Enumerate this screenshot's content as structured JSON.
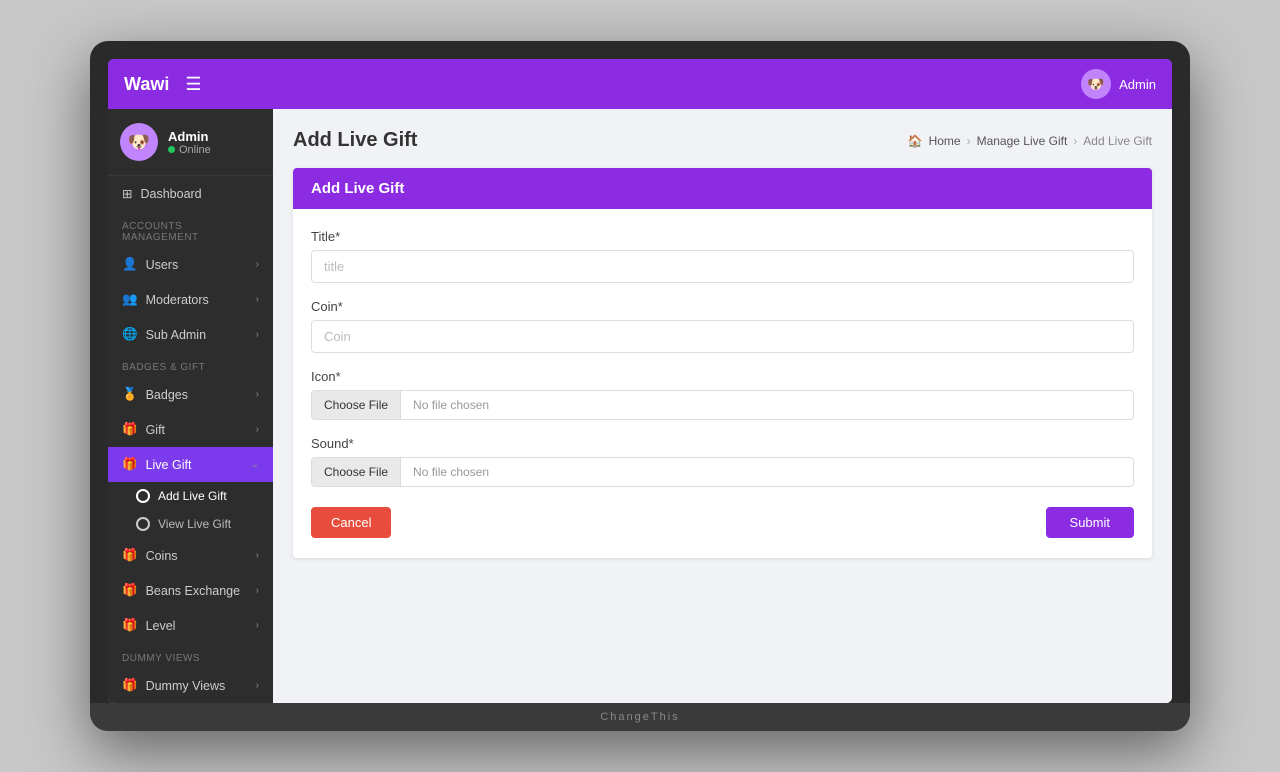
{
  "app": {
    "brand": "Wawi",
    "admin_label": "Admin",
    "menu_icon": "☰"
  },
  "sidebar": {
    "user": {
      "name": "Admin",
      "status": "Online"
    },
    "sections": [
      {
        "label": "",
        "items": [
          {
            "id": "dashboard",
            "icon": "⊞",
            "label": "Dashboard",
            "arrow": ""
          }
        ]
      },
      {
        "label": "ACCOUNTS MANAGEMENT",
        "items": [
          {
            "id": "users",
            "icon": "👤",
            "label": "Users",
            "arrow": "‹"
          },
          {
            "id": "moderators",
            "icon": "👥",
            "label": "Moderators",
            "arrow": "‹"
          },
          {
            "id": "sub-admin",
            "icon": "🌐",
            "label": "Sub Admin",
            "arrow": "‹"
          }
        ]
      },
      {
        "label": "BADGES & GIFT",
        "items": [
          {
            "id": "badges",
            "icon": "🏅",
            "label": "Badges",
            "arrow": "‹"
          },
          {
            "id": "gift",
            "icon": "🎁",
            "label": "Gift",
            "arrow": "‹"
          },
          {
            "id": "live-gift",
            "icon": "🎁",
            "label": "Live Gift",
            "arrow": "⌄",
            "active": true
          }
        ]
      }
    ],
    "live_gift_subitems": [
      {
        "id": "add-live-gift",
        "label": "Add Live Gift",
        "active": true
      },
      {
        "id": "view-live-gift",
        "label": "View Live Gift",
        "active": false
      }
    ],
    "bottom_items": [
      {
        "id": "coins",
        "icon": "🎁",
        "label": "Coins",
        "arrow": "‹"
      },
      {
        "id": "beans-exchange",
        "icon": "🎁",
        "label": "Beans Exchange",
        "arrow": "‹"
      },
      {
        "id": "level",
        "icon": "🎁",
        "label": "Level",
        "arrow": "‹"
      }
    ],
    "dummy_section": {
      "label": "Dummy Views",
      "items": [
        {
          "id": "dummy-views",
          "icon": "🎁",
          "label": "Dummy Views",
          "arrow": "‹"
        }
      ]
    }
  },
  "breadcrumb": {
    "home": "Home",
    "manage": "Manage Live Gift",
    "current": "Add Live Gift"
  },
  "page": {
    "title": "Add Live Gift",
    "card_header": "Add Live Gift"
  },
  "form": {
    "title_label": "Title*",
    "title_placeholder": "title",
    "coin_label": "Coin*",
    "coin_placeholder": "Coin",
    "icon_label": "Icon*",
    "icon_choose_text": "Choose File",
    "icon_no_file": "No file chosen",
    "sound_label": "Sound*",
    "sound_choose_text": "Choose File",
    "sound_no_file": "No file chosen",
    "cancel_label": "Cancel",
    "submit_label": "Submit"
  },
  "laptop_label": "ChangeThis"
}
